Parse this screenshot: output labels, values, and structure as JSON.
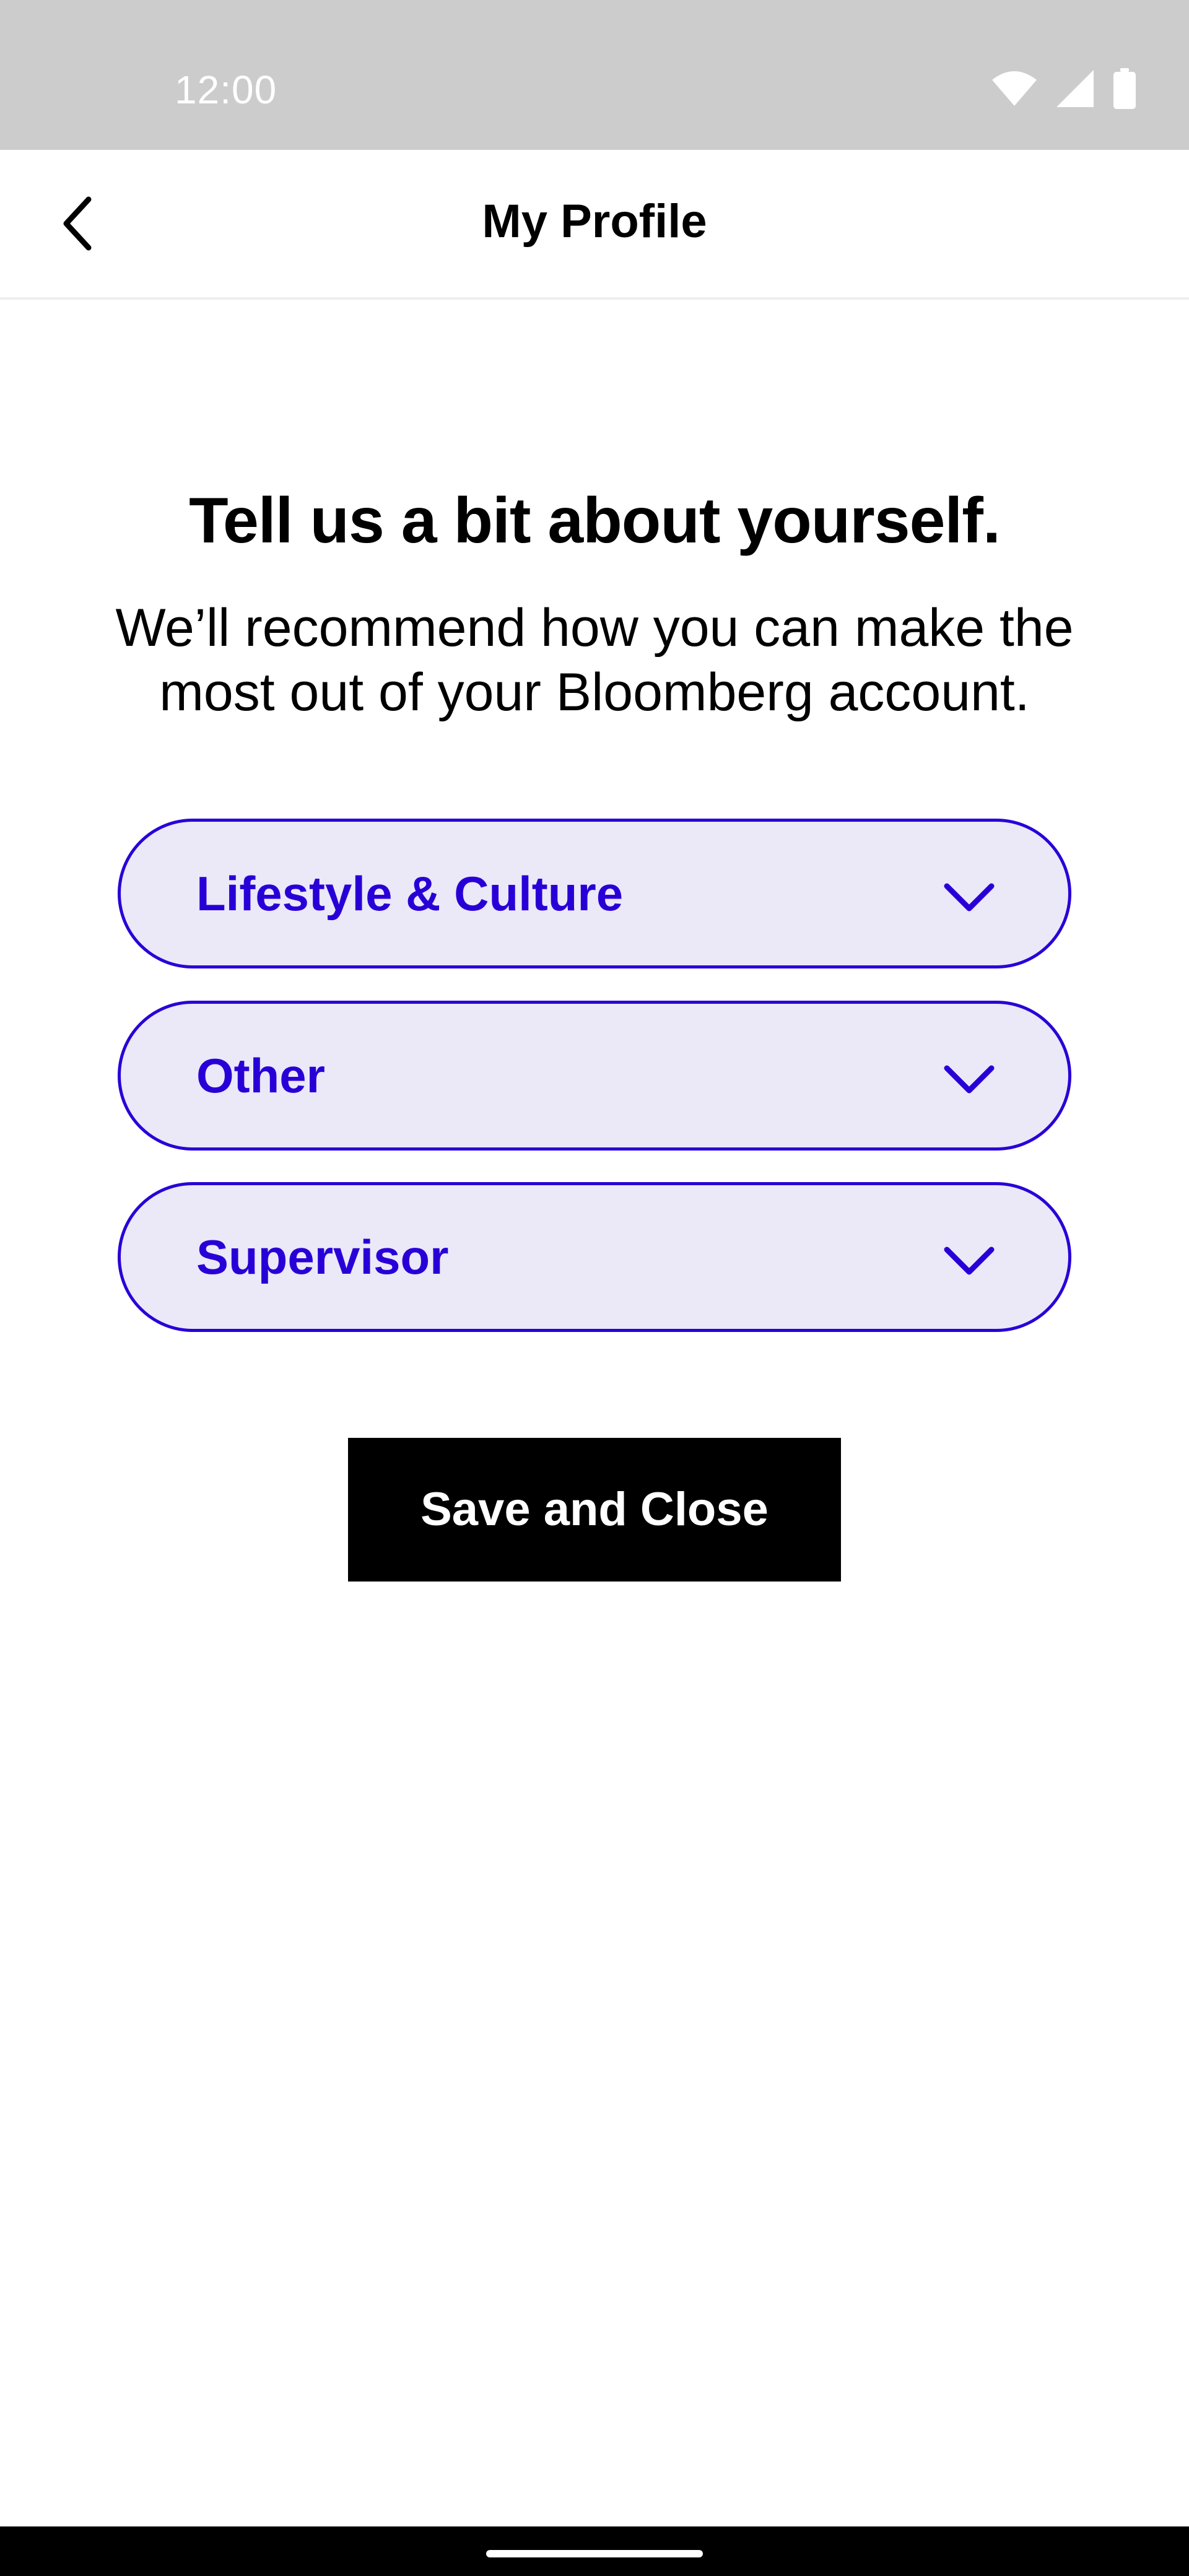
{
  "status_bar": {
    "time": "12:00",
    "icons": [
      "wifi-icon",
      "cell-signal-icon",
      "battery-icon"
    ]
  },
  "app_bar": {
    "title": "My Profile",
    "back_icon": "chevron-left-icon"
  },
  "content": {
    "headline": "Tell us a bit about yourself.",
    "subtext": "We’ll recommend how you can make the most out of your Bloomberg account."
  },
  "dropdowns": [
    {
      "selected": "Lifestyle & Culture",
      "icon": "chevron-down-icon"
    },
    {
      "selected": "Other",
      "icon": "chevron-down-icon"
    },
    {
      "selected": "Supervisor",
      "icon": "chevron-down-icon"
    }
  ],
  "actions": {
    "save_label": "Save and Close"
  },
  "colors": {
    "accent": "#2800d7",
    "dropdown_fill": "#ebe8f8",
    "status_bar": "#cccccc",
    "button_bg": "#000000",
    "button_text": "#ffffff"
  }
}
